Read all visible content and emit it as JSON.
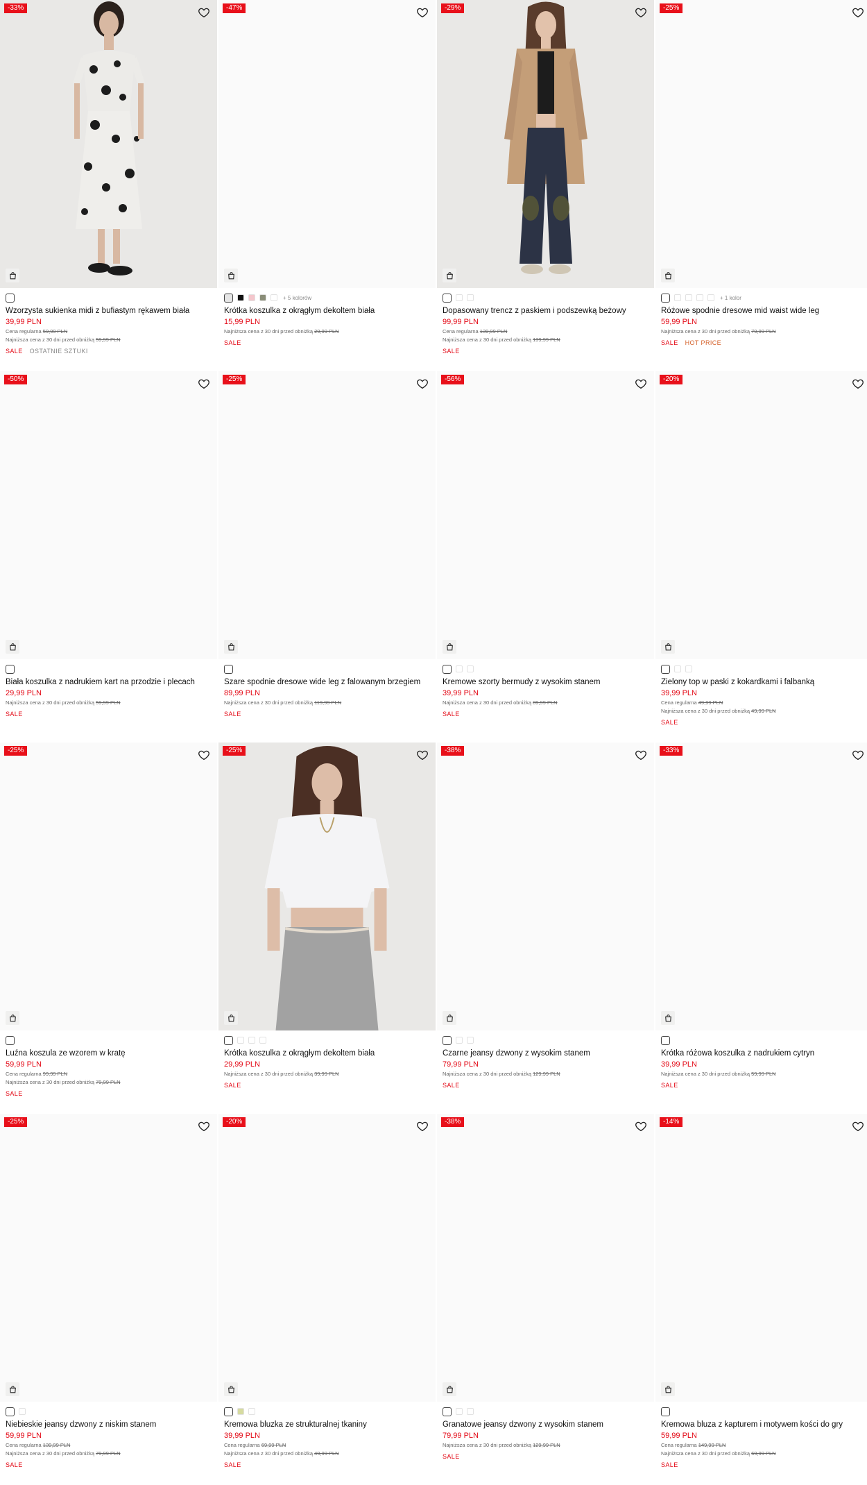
{
  "colors": {
    "sale_red": "#e30613",
    "badge_red": "#e8101a",
    "hot_orange": "#d4612a"
  },
  "labels": {
    "regular": "Cena regularna",
    "lowest": "Najniższa cena z 30 dni przed obniżką",
    "wishlist_icon": "heart-icon",
    "bag_icon": "shopping-bag-icon"
  },
  "products": [
    {
      "badge": "-33%",
      "name": "Wzorzysta sukienka midi z bufiastym rękawem biała",
      "price": "39,99 PLN",
      "regular": "59,99 PLN",
      "lowest": "59,99 PLN",
      "tags": [
        "SALE",
        "OSTATNIE SZTUKI"
      ],
      "swatches": [
        "#ffffff"
      ],
      "more": "",
      "image": "dress"
    },
    {
      "badge": "-47%",
      "name": "Krótka koszulka z okrągłym dekoltem biała",
      "price": "15,99 PLN",
      "regular": "",
      "lowest": "29,99 PLN",
      "tags": [
        "SALE"
      ],
      "swatches": [
        "#e6e6e6",
        "#111111",
        "#f4c6cc",
        "#8a8d78",
        "#ffffff"
      ],
      "more": "+ 5 kolorów",
      "image": "blank"
    },
    {
      "badge": "-29%",
      "name": "Dopasowany trencz z paskiem i podszewką beżowy",
      "price": "99,99 PLN",
      "regular": "139,99 PLN",
      "lowest": "139,99 PLN",
      "tags": [
        "SALE"
      ],
      "swatches": [
        "#ffffff",
        "#ffffff",
        "#ffffff"
      ],
      "more": "",
      "image": "trench"
    },
    {
      "badge": "-25%",
      "name": "Różowe spodnie dresowe mid waist wide leg",
      "price": "59,99 PLN",
      "regular": "",
      "lowest": "79,99 PLN",
      "tags": [
        "SALE",
        "HOT PRICE"
      ],
      "swatches": [
        "#ffffff",
        "#ffffff",
        "#ffffff",
        "#ffffff",
        "#ffffff"
      ],
      "more": "+ 1 kolor",
      "image": "blank"
    },
    {
      "badge": "-50%",
      "name": "Biała koszulka z nadrukiem kart na przodzie i plecach",
      "price": "29,99 PLN",
      "regular": "",
      "lowest": "59,99 PLN",
      "tags": [
        "SALE"
      ],
      "swatches": [
        "#ffffff"
      ],
      "more": "",
      "image": "blank"
    },
    {
      "badge": "-25%",
      "name": "Szare spodnie dresowe wide leg z falowanym brzegiem",
      "price": "89,99 PLN",
      "regular": "",
      "lowest": "119,99 PLN",
      "tags": [
        "SALE"
      ],
      "swatches": [
        "#ffffff"
      ],
      "more": "",
      "image": "blank"
    },
    {
      "badge": "-56%",
      "name": "Kremowe szorty bermudy z wysokim stanem",
      "price": "39,99 PLN",
      "regular": "",
      "lowest": "89,99 PLN",
      "tags": [
        "SALE"
      ],
      "swatches": [
        "#ffffff",
        "#ffffff",
        "#ffffff"
      ],
      "more": "",
      "image": "blank"
    },
    {
      "badge": "-20%",
      "name": "Zielony top w paski z kokardkami i falbanką",
      "price": "39,99 PLN",
      "regular": "49,99 PLN",
      "lowest": "49,99 PLN",
      "tags": [
        "SALE"
      ],
      "swatches": [
        "#ffffff",
        "#ffffff",
        "#ffffff"
      ],
      "more": "",
      "image": "blank"
    },
    {
      "badge": "-25%",
      "name": "Luźna koszula ze wzorem w kratę",
      "price": "59,99 PLN",
      "regular": "99,99 PLN",
      "lowest": "79,99 PLN",
      "tags": [
        "SALE"
      ],
      "swatches": [
        "#ffffff"
      ],
      "more": "",
      "image": "blank"
    },
    {
      "badge": "-25%",
      "name": "Krótka koszulka z okrągłym dekoltem biała",
      "price": "29,99 PLN",
      "regular": "",
      "lowest": "39,99 PLN",
      "tags": [
        "SALE"
      ],
      "swatches": [
        "#ffffff",
        "#ffffff",
        "#ffffff",
        "#ffffff"
      ],
      "more": "",
      "image": "crop"
    },
    {
      "badge": "-38%",
      "name": "Czarne jeansy dzwony z wysokim stanem",
      "price": "79,99 PLN",
      "regular": "",
      "lowest": "129,99 PLN",
      "tags": [
        "SALE"
      ],
      "swatches": [
        "#ffffff",
        "#ffffff",
        "#ffffff"
      ],
      "more": "",
      "image": "blank"
    },
    {
      "badge": "-33%",
      "name": "Krótka różowa koszulka z nadrukiem cytryn",
      "price": "39,99 PLN",
      "regular": "",
      "lowest": "59,99 PLN",
      "tags": [
        "SALE"
      ],
      "swatches": [
        "#ffffff"
      ],
      "more": "",
      "image": "blank"
    },
    {
      "badge": "-25%",
      "name": "Niebieskie jeansy dzwony z niskim stanem",
      "price": "59,99 PLN",
      "regular": "139,99 PLN",
      "lowest": "79,99 PLN",
      "tags": [
        "SALE"
      ],
      "swatches": [
        "#ffffff",
        "#ffffff"
      ],
      "more": "",
      "image": "blank"
    },
    {
      "badge": "-20%",
      "name": "Kremowa bluzka ze strukturalnej tkaniny",
      "price": "39,99 PLN",
      "regular": "69,99 PLN",
      "lowest": "49,99 PLN",
      "tags": [
        "SALE"
      ],
      "swatches": [
        "#ffffff",
        "#d6dba0",
        "#ffffff"
      ],
      "more": "",
      "image": "blank"
    },
    {
      "badge": "-38%",
      "name": "Granatowe jeansy dzwony z wysokim stanem",
      "price": "79,99 PLN",
      "regular": "",
      "lowest": "129,99 PLN",
      "tags": [
        "SALE"
      ],
      "swatches": [
        "#ffffff",
        "#ffffff",
        "#ffffff"
      ],
      "more": "",
      "image": "blank"
    },
    {
      "badge": "-14%",
      "name": "Kremowa bluza z kapturem i motywem kości do gry",
      "price": "59,99 PLN",
      "regular": "149,99 PLN",
      "lowest": "69,99 PLN",
      "tags": [
        "SALE"
      ],
      "swatches": [
        "#ffffff"
      ],
      "more": "",
      "image": "blank"
    }
  ]
}
